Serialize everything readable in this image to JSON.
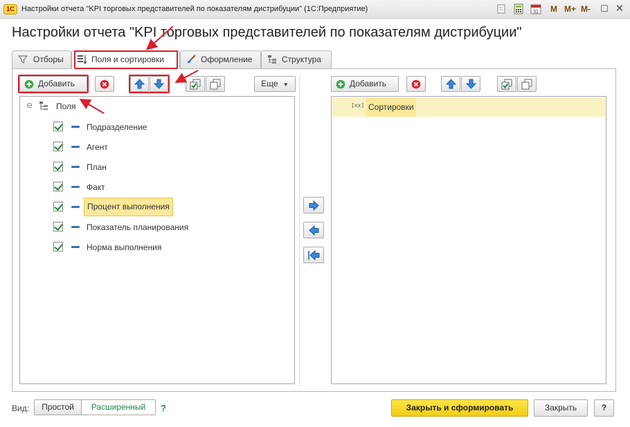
{
  "window": {
    "title": "Настройки отчета \"KPI торговых представителей по показателям дистрибуции\"  (1С:Предприятие)",
    "logo": "1С",
    "controls": {
      "m": "M",
      "m_plus": "M+",
      "m_minus": "M-"
    }
  },
  "page_title": "Настройки отчета \"KPI торговых представителей по показателям дистрибуции\"",
  "tabs": [
    {
      "label": "Отборы",
      "icon": "filter-icon",
      "active": false
    },
    {
      "label": "Поля и сортировки",
      "icon": "fields-sort-icon",
      "active": true
    },
    {
      "label": "Оформление",
      "icon": "brush-icon",
      "active": false
    },
    {
      "label": "Структура",
      "icon": "structure-icon",
      "active": false
    }
  ],
  "left_toolbar": {
    "add_label": "Добавить",
    "more_label": "Еще"
  },
  "fields_tree": {
    "root_label": "Поля",
    "items": [
      {
        "label": "Подразделение",
        "checked": true,
        "selected": false
      },
      {
        "label": "Агент",
        "checked": true,
        "selected": false
      },
      {
        "label": "План",
        "checked": true,
        "selected": false
      },
      {
        "label": "Факт",
        "checked": true,
        "selected": false
      },
      {
        "label": "Процент выполнения",
        "checked": true,
        "selected": true
      },
      {
        "label": "Показатель планирования",
        "checked": true,
        "selected": false
      },
      {
        "label": "Норма выполнения",
        "checked": true,
        "selected": false
      }
    ]
  },
  "right_toolbar": {
    "add_label": "Добавить"
  },
  "sort_tree": {
    "root_label": "Сортировки",
    "root_icon_text": "[xx]"
  },
  "footer": {
    "view_label": "Вид:",
    "view_simple": "Простой",
    "view_extended": "Расширенный",
    "help_link": "?",
    "close_and_generate": "Закрыть и сформировать",
    "close": "Закрыть",
    "help_button": "?"
  },
  "colors": {
    "accent_yellow": "#f5d81e",
    "selection": "#fbe89c",
    "highlight_red": "#d9202a",
    "arrow_blue": "#3a86d6"
  }
}
